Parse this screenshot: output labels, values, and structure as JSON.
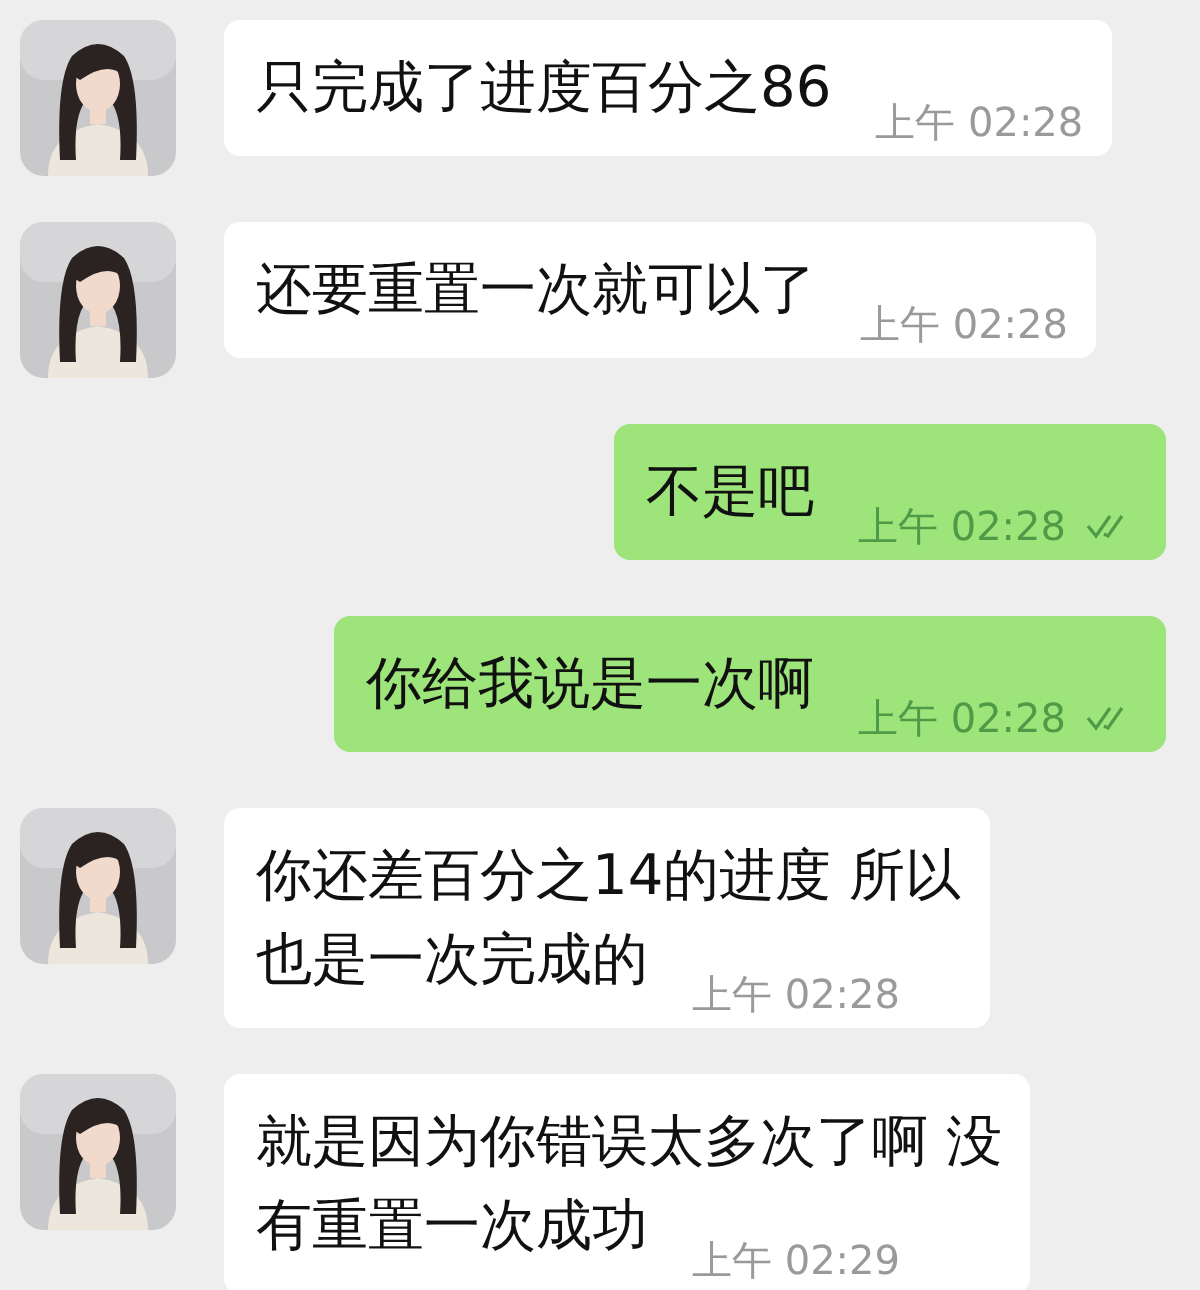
{
  "messages": [
    {
      "kind": "incoming",
      "lines": [
        "只完成了进度百分之86"
      ],
      "time": "上午 02:28",
      "read": false
    },
    {
      "kind": "incoming",
      "lines": [
        "还要重置一次就可以了"
      ],
      "time": "上午 02:28",
      "read": false
    },
    {
      "kind": "outgoing",
      "lines": [
        "不是吧"
      ],
      "time": "上午 02:28",
      "read": true
    },
    {
      "kind": "outgoing",
      "lines": [
        "你给我说是一次啊"
      ],
      "time": "上午 02:28",
      "read": true
    },
    {
      "kind": "incoming",
      "lines": [
        "你还差百分之14的进度 所以",
        "也是一次完成的"
      ],
      "time": "上午 02:28",
      "read": false
    },
    {
      "kind": "incoming",
      "lines": [
        "就是因为你错误太多次了啊 没",
        "有重置一次成功"
      ],
      "time": "上午 02:29",
      "read": false
    }
  ]
}
